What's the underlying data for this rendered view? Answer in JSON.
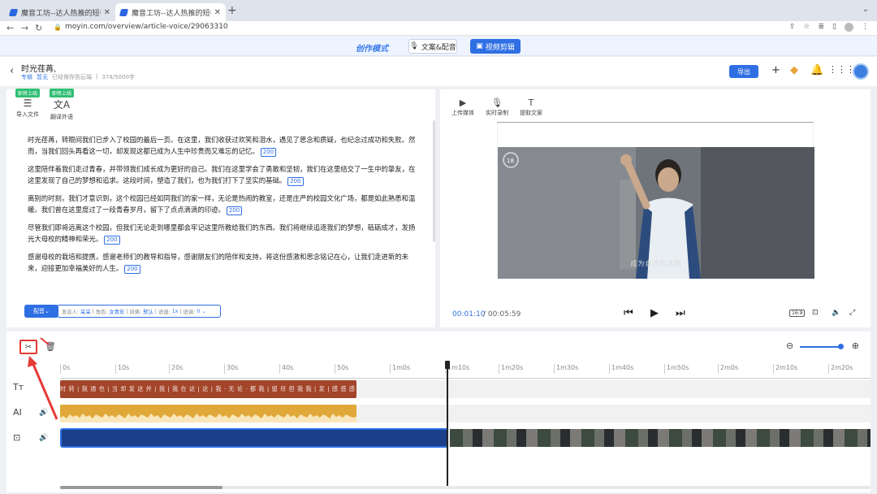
{
  "browser": {
    "tabs": [
      {
        "title": "魔音工坊--达人热推的短视频/有",
        "active": false
      },
      {
        "title": "魔音工坊--达人热推的短视频/有",
        "active": true
      }
    ],
    "url": "moyin.com/overview/article-voice/29063310"
  },
  "modebar": {
    "title": "创作模式",
    "text_dub_label": "文案&配音",
    "video_edit_label": "视频剪辑"
  },
  "header": {
    "doc_title": "时光荏苒,",
    "meta_category": "专辑",
    "meta_status": "暂无",
    "meta_saved": "已经保存到云端",
    "meta_count": "374/5000字",
    "export_label": "导出"
  },
  "editor": {
    "tools": [
      {
        "label": "导入文件",
        "badge": "即将上线"
      },
      {
        "label": "翻译外语",
        "badge": "即将上线"
      }
    ],
    "paragraphs": [
      {
        "text": "时光荏苒，转眼间我们已步入了校园的最后一页。在这里，我们收获过欢笑和泪水，遇见了思念和质疑，也纪念过成功和失败。然而，当我们回头再看这一切，却发现这都已成为人生中珍贵而又难忘的记忆。",
        "count": "200"
      },
      {
        "text": "这里陪伴着我们走过青春，并带领我们成长成为更好的自己。我们在这里学会了勇敢和坚韧，我们在这里结交了一生中的挚友，在这里发现了自己的梦想和追求。这段时间，塑造了我们，也为我们打下了坚实的基础。",
        "count": "200"
      },
      {
        "text": "离别的时刻，我们才意识到，这个校园已经如同我们的家一样，无论是热闹的教室，还是庄严的校园文化广场，都是如此熟悉和温暖。我们曾在这里度过了一段青春岁月，留下了点点滴滴的印迹。",
        "count": "200"
      },
      {
        "text": "尽管我们即将远离这个校园，但我们无论走到哪里都会牢记这里所教给我们的东西。我们将继续追逐我们的梦想，砥砺成才，发扬光大母校的精神和荣光。",
        "count": "200"
      },
      {
        "text": "感谢母校的栽培和提携，感谢老师们的教导和指导，感谢朋友们的陪伴和支持，将这份感激和思念铭记在心，让我们走进新的未来，迎接更加幸福美好的人生。",
        "count": "200"
      }
    ],
    "dub_label": "配音",
    "voice": {
      "speaker_key": "发音人:",
      "speaker": "采采",
      "role_key": "角色:",
      "role": "女青年",
      "style_key": "风格:",
      "style": "默认",
      "speed_key": "语速:",
      "speed": "1x",
      "pitch_key": "语调:",
      "pitch": "0"
    }
  },
  "preview": {
    "tools": [
      {
        "label": "上传媒体",
        "icon": "upload-media-icon"
      },
      {
        "label": "实时录制",
        "icon": "microphone-icon"
      },
      {
        "label": "提取文案",
        "icon": "text-extract-icon"
      }
    ],
    "subtitle": "成为自己的太阳",
    "time_current": "00:01:10",
    "time_total": "00:05:59",
    "ratio_label": "16:9",
    "corner_logo": "18"
  },
  "timeline": {
    "ruler": [
      "0s",
      "10s",
      "20s",
      "30s",
      "40s",
      "50s",
      "1m0s",
      "1m10s",
      "1m20s",
      "1m30s",
      "1m40s",
      "1m50s",
      "2m0s",
      "2m10s",
      "2m20s"
    ],
    "tracks": [
      {
        "icon": "Tт"
      },
      {
        "icon": "AI"
      },
      {
        "icon": "video-track-icon"
      }
    ],
    "text_clip": "时 转 | 我 通 也 | 当 却 发 这 并 | 我 | 我 在 这 | 这 | 我 · 无 论 · 都 我 | 留 尽 但 我 我 | 发 | 感 感 感 将 | 让 迎"
  },
  "colors": {
    "accent": "#2f6fe4",
    "text_clip": "#a3452a",
    "audio_clip": "#e0a838",
    "highlight_red": "#e53935"
  }
}
